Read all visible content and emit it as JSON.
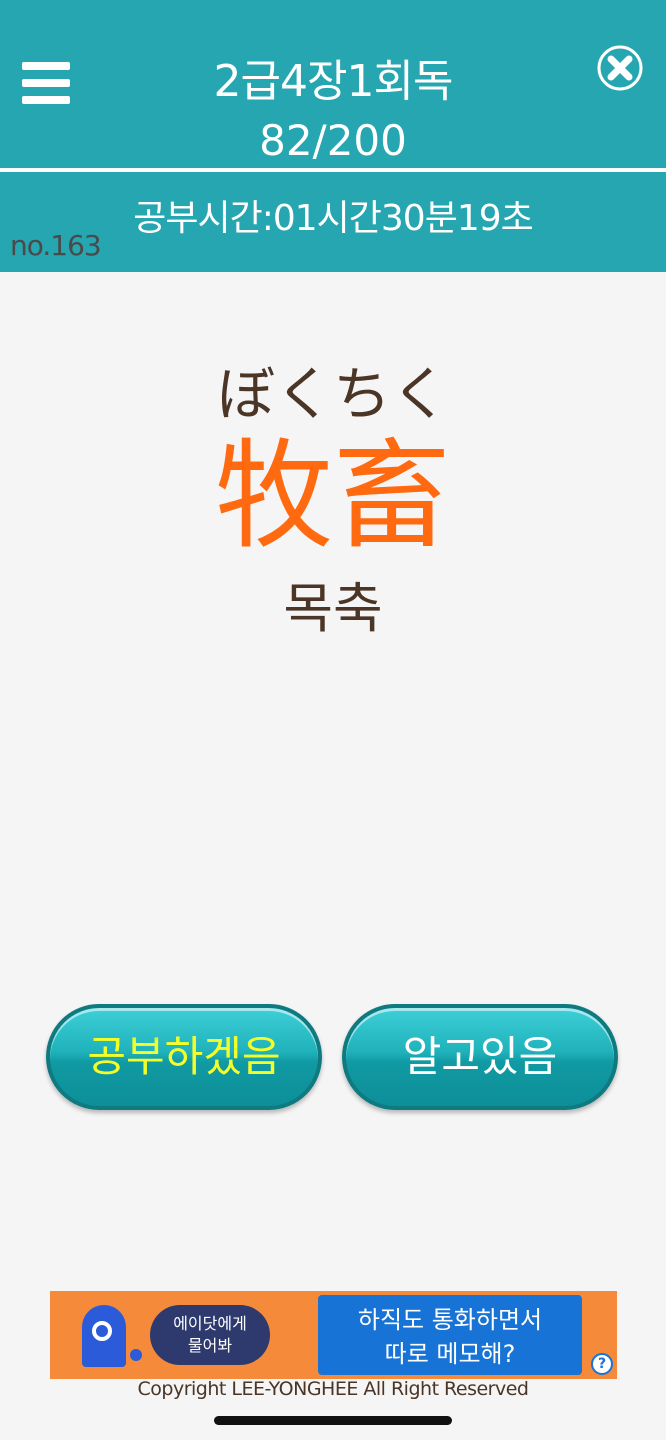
{
  "header": {
    "title": "2급4장1회독",
    "progress": "82/200",
    "menu_icon": "hamburger-menu-icon",
    "close_icon": "close-circle-icon"
  },
  "subheader": {
    "study_time": "공부시간:01시간30분19초",
    "card_number": "no.163"
  },
  "card": {
    "reading": "ぼくちく",
    "kanji": "牧畜",
    "meaning": "목축"
  },
  "buttons": {
    "study_label": "공부하겠음",
    "known_label": "알고있음"
  },
  "ad": {
    "bubble_line1": "에이닷에게",
    "bubble_line2": "물어봐",
    "box_line1": "하직도 통화하면서",
    "box_line2": "따로 메모해?",
    "info_label": "?"
  },
  "footer": {
    "copyright": "Copyright LEE-YONGHEE All Right Reserved"
  },
  "colors": {
    "header_bg": "#25a6b0",
    "kanji": "#ff6a10",
    "text_brown": "#4a3526",
    "study_button_text": "#f4ff2a"
  }
}
